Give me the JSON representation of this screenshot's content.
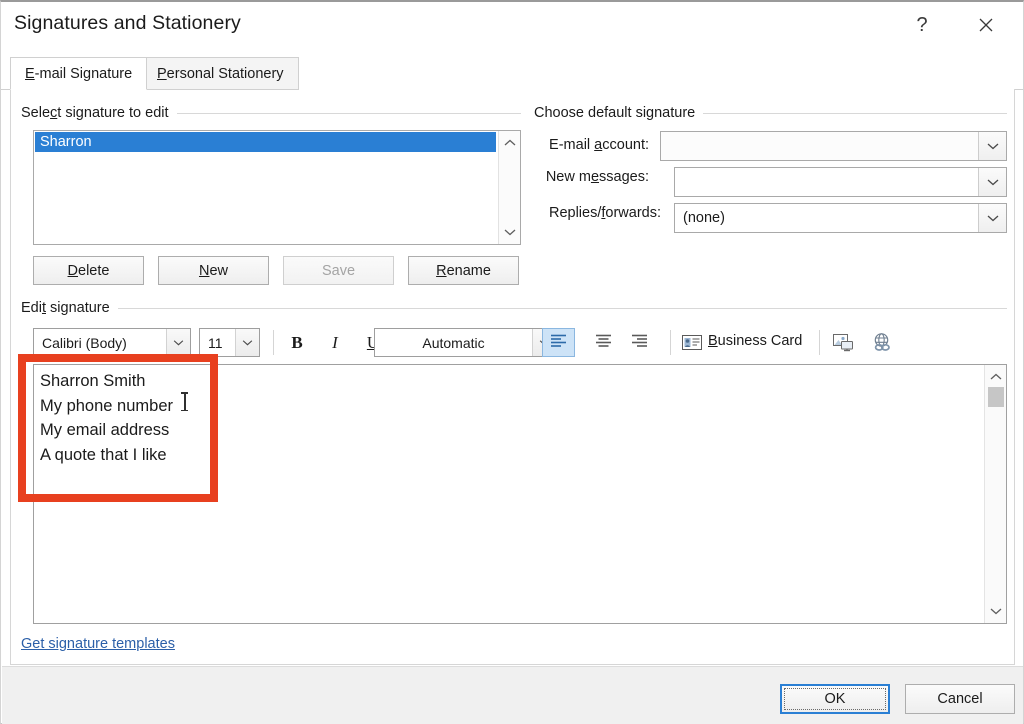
{
  "window": {
    "title": "Signatures and Stationery",
    "help_icon": "question-mark-icon",
    "close_icon": "close-icon"
  },
  "tabs": [
    {
      "label_prefix": "E",
      "label_rest": "-mail Signature",
      "active": true
    },
    {
      "label_prefix": "P",
      "label_rest": "ersonal Stationery",
      "active": false
    }
  ],
  "select_signature": {
    "group_label_a": "Sele",
    "group_label_accel": "c",
    "group_label_b": "t signature to edit",
    "items": [
      "Sharron"
    ],
    "selected": "Sharron",
    "scroll_up_icon": "chevron-up-icon",
    "scroll_down_icon": "chevron-down-icon",
    "buttons": [
      {
        "accel": "D",
        "rest": "elete",
        "disabled": false
      },
      {
        "accel": "N",
        "rest": "ew",
        "disabled": false
      },
      {
        "accel": "",
        "rest": "Save",
        "disabled": true
      },
      {
        "accel": "R",
        "rest": "ename",
        "disabled": false
      }
    ]
  },
  "default_signature": {
    "group_label": "Choose default signature",
    "fields": [
      {
        "label_a": "E-mail ",
        "label_accel": "a",
        "label_b": "ccount:",
        "value": "",
        "dim": true
      },
      {
        "label_a": "New m",
        "label_accel": "e",
        "label_b": "ssages:",
        "value": "",
        "dim": false
      },
      {
        "label_a": "Replies/",
        "label_accel": "f",
        "label_b": "orwards:",
        "value": "(none)",
        "dim": false
      }
    ],
    "dropdown_icon": "chevron-down-icon"
  },
  "edit_signature": {
    "group_label_a": "Edi",
    "group_label_accel": "t",
    "group_label_b": " signature",
    "toolbar": {
      "font_family": "Calibri (Body)",
      "font_size": "11",
      "bold_label": "B",
      "italic_label": "I",
      "underline_label": "U",
      "font_color": "Automatic",
      "align_left_icon": "align-left-icon",
      "align_center_icon": "align-center-icon",
      "align_right_icon": "align-right-icon",
      "active_alignment": "align-left",
      "business_card_accel": "B",
      "business_card_rest": "usiness Card",
      "business_card_icon": "business-card-icon",
      "picture_icon": "insert-picture-icon",
      "hyperlink_icon": "insert-hyperlink-icon",
      "dropdown_icon": "chevron-down-icon"
    },
    "content_lines": [
      "Sharron Smith",
      "My phone number",
      "My email address",
      "A quote that I like"
    ],
    "scroll_up_icon": "chevron-up-icon",
    "scroll_down_icon": "chevron-down-icon"
  },
  "templates_link": "Get signature templates",
  "footer": {
    "ok_label": "OK",
    "cancel_label": "Cancel"
  },
  "colors": {
    "selection_blue": "#2a7fd4",
    "annotation_red": "#e8401f",
    "link_blue": "#2b5fa8",
    "toolbar_active": "#cde3f7"
  }
}
